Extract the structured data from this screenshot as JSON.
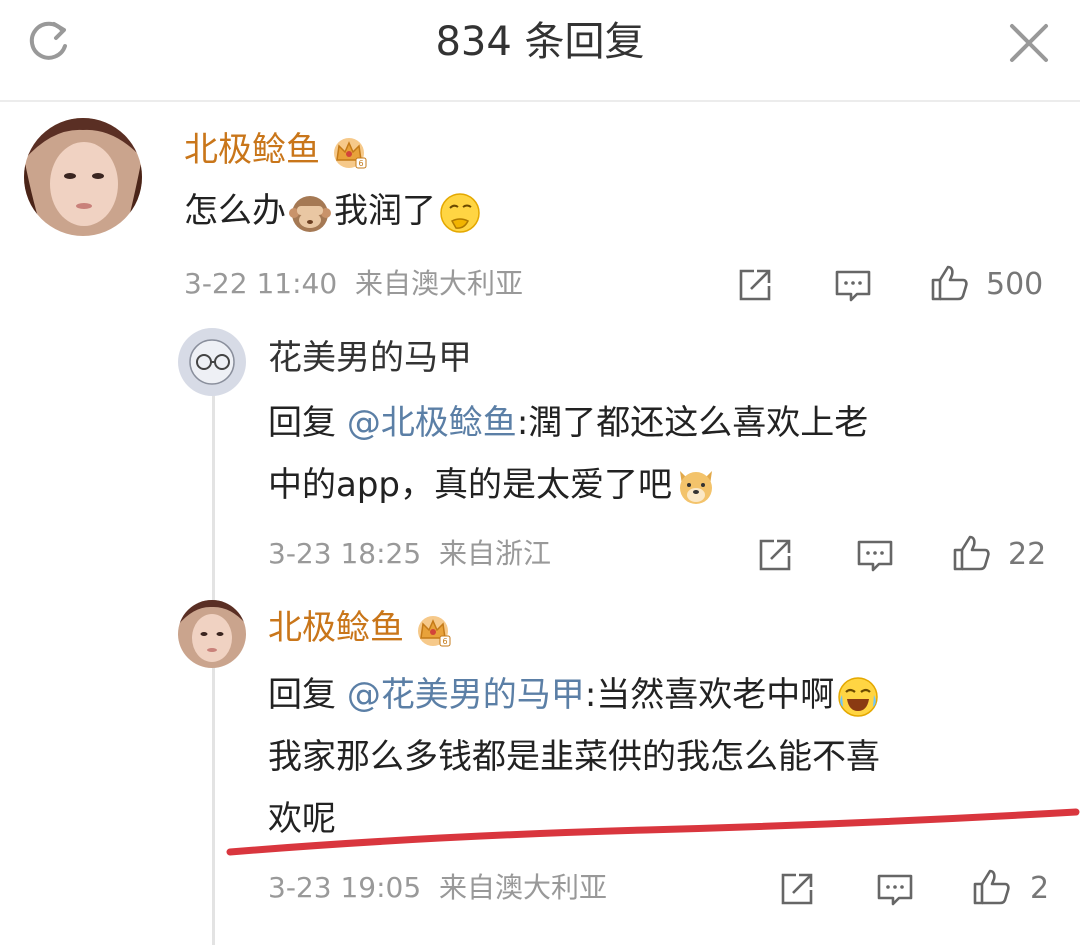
{
  "header": {
    "title": "834 条回复",
    "refresh_icon": "refresh-icon",
    "close_icon": "close-icon"
  },
  "colors": {
    "vip_name": "#c9761a",
    "mention": "#5b7fa6",
    "meta": "#999999",
    "annotation": "#d9363e"
  },
  "comments": [
    {
      "username": "北极鲶鱼",
      "badge": "crown-badge-icon",
      "text_parts": [
        "怎么办",
        "我润了"
      ],
      "emojis": [
        "see-no-evil-monkey-emoji",
        "thinking-face-emoji"
      ],
      "time": "3-22 11:40",
      "location": "来自澳大利亚",
      "likes": "500"
    },
    {
      "username": "花美男的马甲",
      "reply_prefix": "回复 ",
      "reply_to": "@北极鲶鱼",
      "line1_rest": ":潤了都还这么喜欢上老",
      "line2": "中的app，真的是太爱了吧",
      "emoji": "dog-face-emoji",
      "time": "3-23 18:25",
      "location": "来自浙江",
      "likes": "22"
    },
    {
      "username": "北极鲶鱼",
      "badge": "crown-badge-icon",
      "reply_prefix": "回复 ",
      "reply_to": "@花美男的马甲",
      "line1_rest": ":当然喜欢老中啊",
      "emoji": "tears-of-joy-emoji",
      "line2": "我家那么多钱都是韭菜供的我怎么能不喜",
      "line3": "欢呢",
      "time": "3-23 19:05",
      "location": "来自澳大利亚",
      "likes": "2"
    }
  ]
}
